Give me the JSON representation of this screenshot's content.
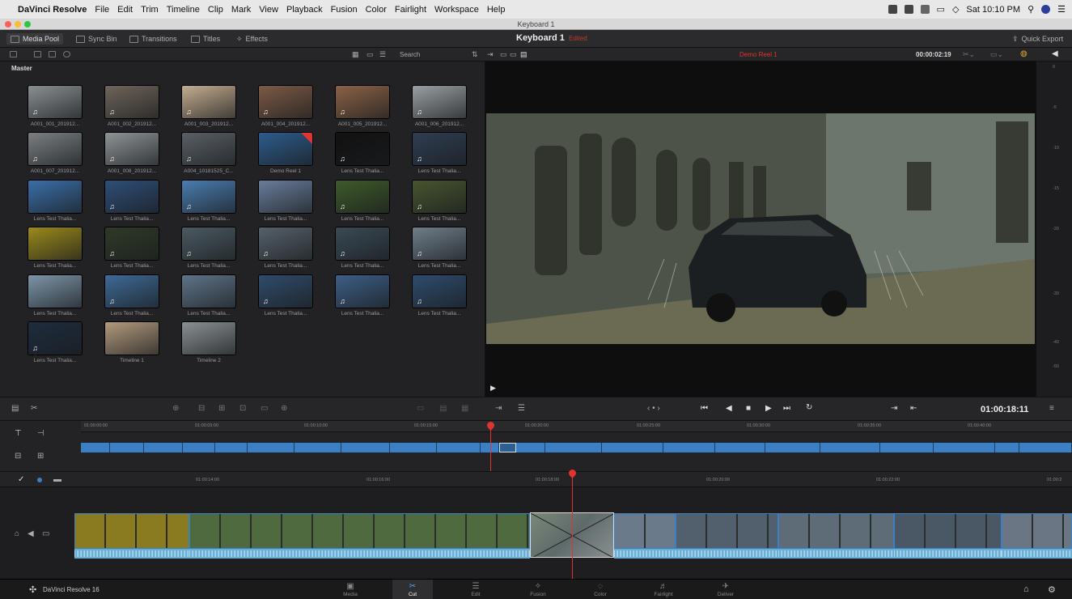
{
  "menubar": {
    "app": "DaVinci Resolve",
    "items": [
      "File",
      "Edit",
      "Trim",
      "Timeline",
      "Clip",
      "Mark",
      "View",
      "Playback",
      "Fusion",
      "Color",
      "Fairlight",
      "Workspace",
      "Help"
    ],
    "clock": "Sat 10:10 PM"
  },
  "window_title": "Keyboard 1",
  "toolbar": {
    "media_pool": "Media Pool",
    "sync_bin": "Sync Bin",
    "transitions": "Transitions",
    "titles": "Titles",
    "effects": "Effects",
    "timeline_name": "Keyboard 1",
    "timeline_status": "Edited",
    "quick_export": "Quick Export"
  },
  "pool": {
    "search_label": "Search",
    "bin": "Master",
    "clips": [
      {
        "label": "A001_001_201912...",
        "tone": "#8a8f92",
        "note": true
      },
      {
        "label": "A001_002_201912...",
        "tone": "#6f655a",
        "note": true
      },
      {
        "label": "A001_003_201912...",
        "tone": "#c4ad8f",
        "note": true
      },
      {
        "label": "A001_004_201912...",
        "tone": "#7c5a45",
        "note": true
      },
      {
        "label": "A001_005_201912...",
        "tone": "#8b6246",
        "note": true
      },
      {
        "label": "A001_006_201912...",
        "tone": "#9aa0a3",
        "note": true
      },
      {
        "label": "A001_007_201912...",
        "tone": "#7a7f82",
        "note": true
      },
      {
        "label": "A001_008_201912...",
        "tone": "#8f9496",
        "note": true
      },
      {
        "label": "A004_10181525_C...",
        "tone": "#5a6066",
        "note": true
      },
      {
        "label": "Demo Reel 1",
        "tone": "#2d5c8c",
        "note": false,
        "flag": true
      },
      {
        "label": "Lens Test Thalia...",
        "tone": "#111111",
        "note": true
      },
      {
        "label": "Lens Test Thalia...",
        "tone": "#2f3e52",
        "note": true
      },
      {
        "label": "Lens Test Thalia...",
        "tone": "#3a6fa8",
        "note": false
      },
      {
        "label": "Lens Test Thalia...",
        "tone": "#2f4e78",
        "note": true
      },
      {
        "label": "Lens Test Thalia...",
        "tone": "#4a7db0",
        "note": true
      },
      {
        "label": "Lens Test Thalia...",
        "tone": "#6a7d9c",
        "note": false
      },
      {
        "label": "Lens Test Thalia...",
        "tone": "#3f5a2a",
        "note": true
      },
      {
        "label": "Lens Test Thalia...",
        "tone": "#47552f",
        "note": true
      },
      {
        "label": "Lens Test Thalia...",
        "tone": "#9a8a1a",
        "note": false
      },
      {
        "label": "Lens Test Thalia...",
        "tone": "#2f3a28",
        "note": true
      },
      {
        "label": "Lens Test Thalia...",
        "tone": "#4b5a62",
        "note": true
      },
      {
        "label": "Lens Test Thalia...",
        "tone": "#56616a",
        "note": true
      },
      {
        "label": "Lens Test Thalia...",
        "tone": "#3a4a55",
        "note": true
      },
      {
        "label": "Lens Test Thalia...",
        "tone": "#6f7e8a",
        "note": true
      },
      {
        "label": "Lens Test Thalia...",
        "tone": "#7d95a8",
        "note": false
      },
      {
        "label": "Lens Test Thalia...",
        "tone": "#3e6a96",
        "note": true
      },
      {
        "label": "Lens Test Thalia...",
        "tone": "#5f7489",
        "note": false
      },
      {
        "label": "Lens Test Thalia...",
        "tone": "#2f4c6a",
        "note": true
      },
      {
        "label": "Lens Test Thalia...",
        "tone": "#3d5f86",
        "note": true
      },
      {
        "label": "Lens Test Thalia...",
        "tone": "#2e4c6e",
        "note": true
      },
      {
        "label": "Lens Test Thalia...",
        "tone": "#1e2c3e",
        "note": true
      },
      {
        "label": "Timeline 1",
        "tone": "#b39a7d",
        "note": false
      },
      {
        "label": "Timeline 2",
        "tone": "#8a9092",
        "note": false
      }
    ]
  },
  "viewer": {
    "clip_name": "Demo Reel 1",
    "duration": "00:00:02:19",
    "meter_ticks": [
      "0",
      "-5",
      "-10",
      "-15",
      "-20",
      "-30",
      "-40",
      "-50"
    ]
  },
  "transport": {
    "timecode": "01:00:18:11"
  },
  "upper_ruler": [
    "01:00:00:00",
    "01:00:05:00",
    "01:00:10:00",
    "01:00:15:00",
    "01:00:20:00",
    "01:00:25:00",
    "01:00:30:00",
    "01:00:35:00",
    "01:00:40:00"
  ],
  "lower_ruler": [
    "01:00:14:00",
    "01:00:16:00",
    "01:00:18:00",
    "01:00:20:00",
    "01:00:22:00",
    "01:00:2"
  ],
  "lower_clips": [
    {
      "tone": "#8a7a20"
    },
    {
      "tone": "#4f6a3e"
    },
    {
      "tone": "#6a7a8a"
    },
    {
      "tone": "#52606e"
    },
    {
      "tone": "#5e6c78"
    },
    {
      "tone": "#4a5866"
    },
    {
      "tone": "#6a7684"
    }
  ],
  "pages": [
    {
      "label": "Media",
      "icon": "▣"
    },
    {
      "label": "Cut",
      "icon": "✂"
    },
    {
      "label": "Edit",
      "icon": "☰"
    },
    {
      "label": "Fusion",
      "icon": "✧"
    },
    {
      "label": "Color",
      "icon": "◌"
    },
    {
      "label": "Fairlight",
      "icon": "♬"
    },
    {
      "label": "Deliver",
      "icon": "✈"
    }
  ],
  "product": "DaVinci Resolve 16",
  "colors": {
    "accent": "#3b7fc4",
    "playhead": "#e0342f",
    "active_page_icon": "#4aa3e8"
  }
}
